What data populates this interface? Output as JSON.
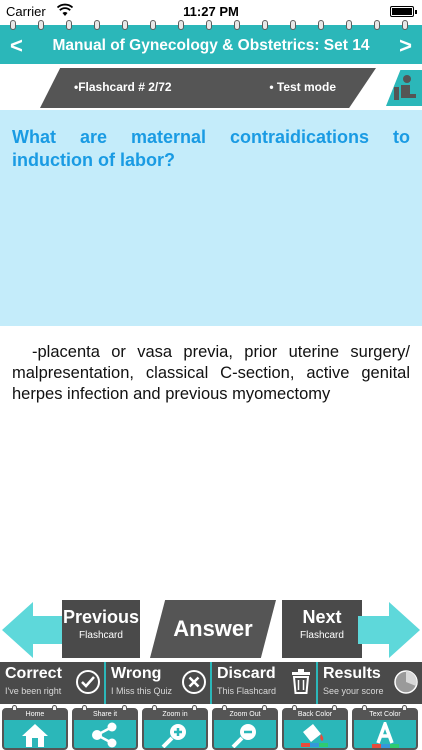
{
  "status_bar": {
    "carrier": "Carrier",
    "time": "11:27 PM"
  },
  "header": {
    "title": "Manual of Gynecology & Obstetrics: Set 14",
    "prev_glyph": "<",
    "next_glyph": ">"
  },
  "info_bar": {
    "flashcard_label": "•Flashcard #  2/72",
    "mode_label": "• Test mode"
  },
  "card": {
    "question": "What are maternal contraidications to induction of labor?",
    "answer": "-placenta or vasa previa, prior uterine surgery/ malpresentation, classical C-section, active genital herpes infection and previous myomectomy"
  },
  "navigation": {
    "previous": {
      "label": "Previous",
      "sub": "Flashcard"
    },
    "answer": "Answer",
    "next": {
      "label": "Next",
      "sub": "Flashcard"
    }
  },
  "grading": {
    "correct": {
      "label": "Correct",
      "sub": "I've been right",
      "icon": "check-circle-icon"
    },
    "wrong": {
      "label": "Wrong",
      "sub": "I Miss this Quiz",
      "icon": "x-circle-icon"
    },
    "discard": {
      "label": "Discard",
      "sub": "This Flashcard",
      "icon": "trash-icon"
    },
    "results": {
      "label": "Results",
      "sub": "See your score",
      "icon": "pie-chart-icon"
    }
  },
  "toolbar": [
    {
      "label": "Home",
      "icon": "home-icon"
    },
    {
      "label": "Share it",
      "icon": "share-icon"
    },
    {
      "label": "Zoom in",
      "icon": "zoom-in-icon"
    },
    {
      "label": "Zoom Out",
      "icon": "zoom-out-icon"
    },
    {
      "label": "Back Color",
      "icon": "paint-bucket-icon"
    },
    {
      "label": "Text Color",
      "icon": "text-color-icon"
    }
  ],
  "colors": {
    "accent": "#2bb7b9",
    "question_bg": "#c4ecfa",
    "question_text": "#1a9be3",
    "dark_button": "#4a4a4a"
  }
}
